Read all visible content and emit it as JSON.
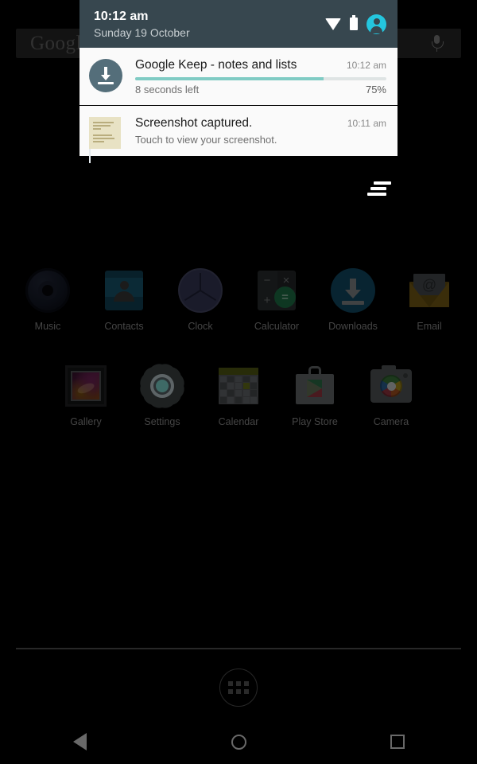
{
  "search": {
    "logo_text": "Google",
    "mic_icon": "microphone-icon"
  },
  "shade": {
    "time": "10:12 am",
    "date": "Sunday 19 October",
    "status_icons": [
      "wifi-icon",
      "battery-icon",
      "user-avatar-icon"
    ],
    "clear_all_label": "clear-all-notifications",
    "header_bg": "#37474f",
    "accent": "#80cbc4"
  },
  "notifications": [
    {
      "id": "download",
      "icon": "download-circle-icon",
      "title": "Google Keep - notes and lists",
      "time": "10:12 am",
      "subtitle": "8 seconds left",
      "percent_label": "75%",
      "progress": 75
    },
    {
      "id": "screenshot",
      "icon": "screenshot-thumbnail-icon",
      "title": "Screenshot captured.",
      "time": "10:11 am",
      "subtitle": "Touch to view your screenshot."
    }
  ],
  "homescreen": {
    "rows": [
      [
        {
          "label": "Music",
          "icon": "music-app-icon"
        },
        {
          "label": "Contacts",
          "icon": "contacts-app-icon"
        },
        {
          "label": "Clock",
          "icon": "clock-app-icon"
        },
        {
          "label": "Calculator",
          "icon": "calculator-app-icon"
        },
        {
          "label": "Downloads",
          "icon": "downloads-app-icon"
        },
        {
          "label": "Email",
          "icon": "email-app-icon"
        }
      ],
      [
        {
          "label": "Gallery",
          "icon": "gallery-app-icon"
        },
        {
          "label": "Settings",
          "icon": "settings-app-icon"
        },
        {
          "label": "Calendar",
          "icon": "calendar-app-icon"
        },
        {
          "label": "Play Store",
          "icon": "play-store-app-icon"
        },
        {
          "label": "Camera",
          "icon": "camera-app-icon"
        }
      ]
    ],
    "calculator_keys": [
      "−",
      "×",
      "+",
      "="
    ],
    "email_at": "@",
    "drawer_label": "app-drawer-button"
  },
  "navbar": {
    "back": "back-button",
    "home": "home-button",
    "recents": "recents-button"
  }
}
